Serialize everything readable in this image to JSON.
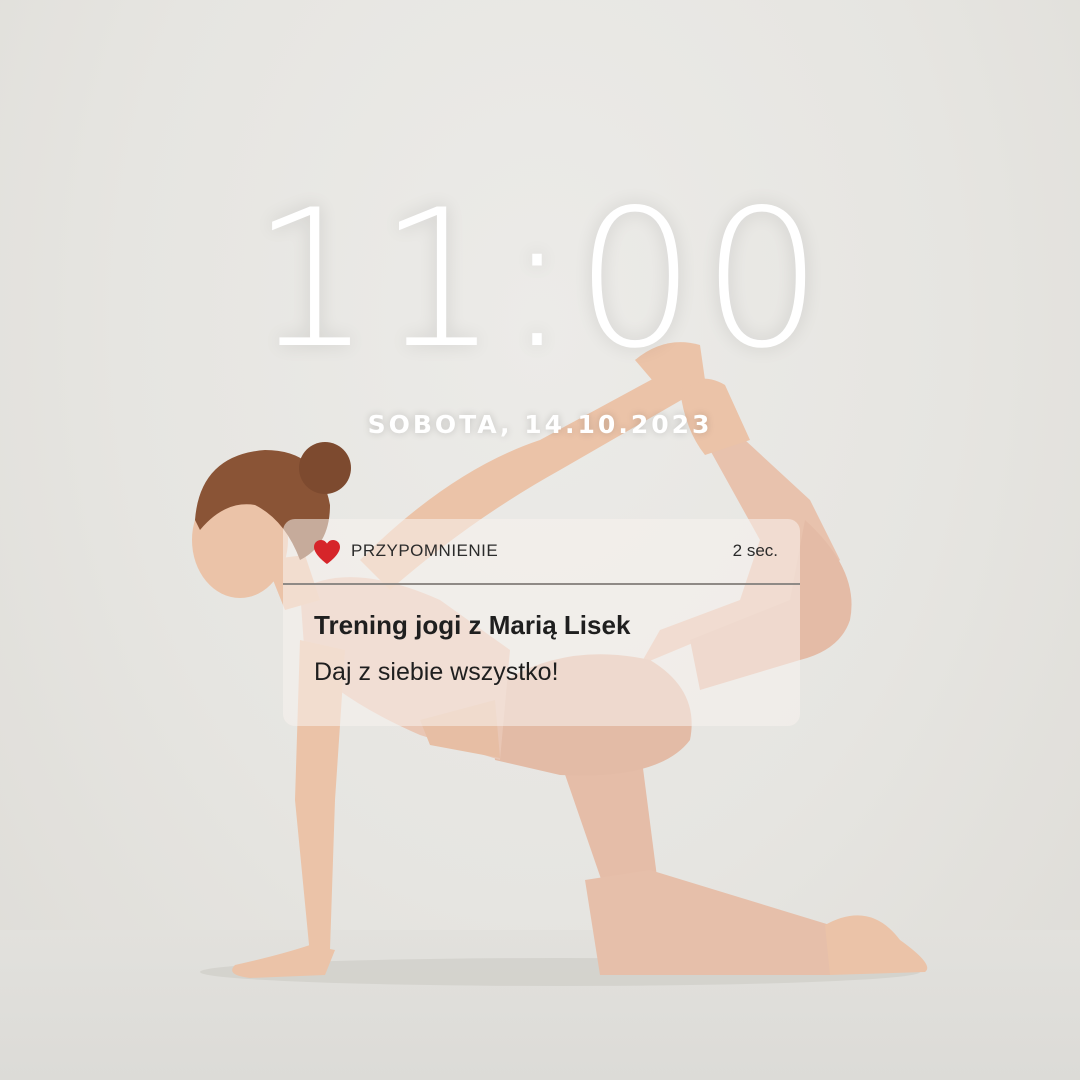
{
  "lockscreen": {
    "time": "11:00",
    "date": "SOBOTA, 14.10.2023"
  },
  "notification": {
    "icon": "heart-icon",
    "app_name": "PRZYPOMNIENIE",
    "time_ago": "2 sec.",
    "title": "Trening jogi z Marią Lisek",
    "body": "Daj z siebie wszystko!"
  },
  "colors": {
    "heart": "#d6252a",
    "clock_text": "#ffffff",
    "outfit": "#e8c3b0",
    "hair": "#8a5436",
    "skin": "#ebc3a8"
  }
}
